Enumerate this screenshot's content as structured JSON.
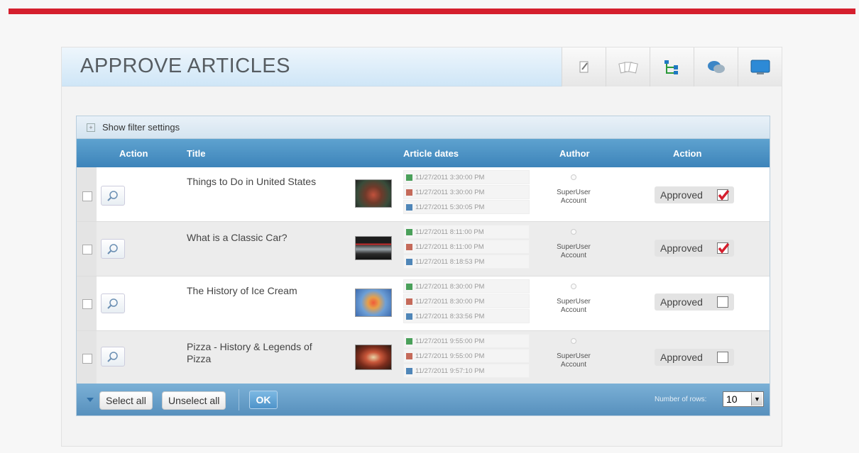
{
  "colors": {
    "accent": "#d51f2e",
    "header_blue": "#3d84ba",
    "check_red": "#d51f2e"
  },
  "page": {
    "title": "APPROVE ARTICLES"
  },
  "header_icons": [
    "write-icon",
    "cards-icon",
    "hierarchy-icon",
    "comments-icon",
    "monitor-icon"
  ],
  "filter": {
    "label": "Show filter settings"
  },
  "columns": {
    "action1": "Action",
    "title": "Title",
    "dates": "Article dates",
    "author": "Author",
    "action2": "Action"
  },
  "rows": [
    {
      "title": "Things to Do in United States",
      "thumb": "food-plate",
      "dates": [
        "11/27/2011 3:30:00 PM",
        "11/27/2011 3:30:00 PM",
        "11/27/2011 5:30:05 PM"
      ],
      "author": "SuperUser Account",
      "status": "Approved",
      "checked": true
    },
    {
      "title": "What is a Classic Car?",
      "thumb": "car",
      "dates": [
        "11/27/2011 8:11:00 PM",
        "11/27/2011 8:11:00 PM",
        "11/27/2011 8:18:53 PM"
      ],
      "author": "SuperUser Account",
      "status": "Approved",
      "checked": true
    },
    {
      "title": "The History of Ice Cream",
      "thumb": "ice-cream",
      "dates": [
        "11/27/2011 8:30:00 PM",
        "11/27/2011 8:30:00 PM",
        "11/27/2011 8:33:56 PM"
      ],
      "author": "SuperUser Account",
      "status": "Approved",
      "checked": false
    },
    {
      "title": "Pizza - History & Legends of Pizza",
      "thumb": "pizza",
      "dates": [
        "11/27/2011 9:55:00 PM",
        "11/27/2011 9:55:00 PM",
        "11/27/2011 9:57:10 PM"
      ],
      "author": "SuperUser Account",
      "status": "Approved",
      "checked": false
    }
  ],
  "footer": {
    "select_all": "Select all",
    "unselect_all": "Unselect all",
    "ok": "OK",
    "rows_label": "Number of rows:",
    "rows_value": "10"
  }
}
